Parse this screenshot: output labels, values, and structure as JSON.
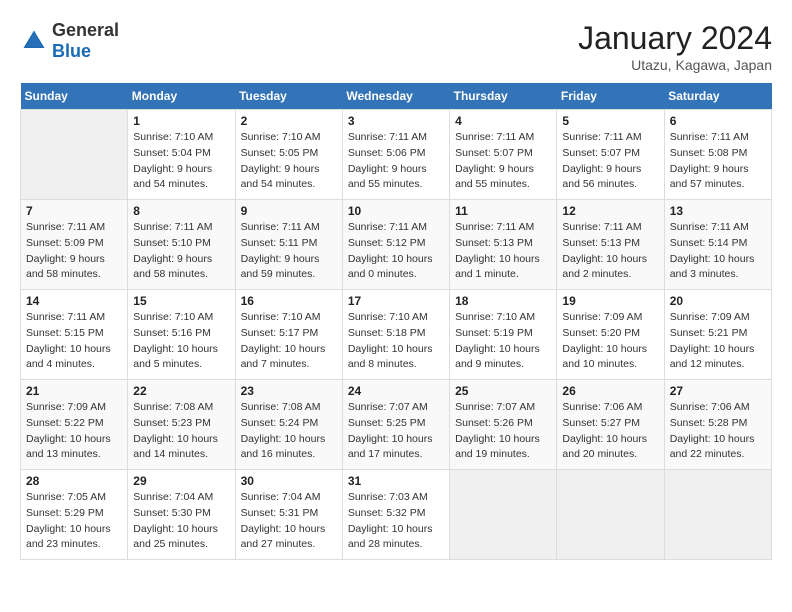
{
  "header": {
    "logo_general": "General",
    "logo_blue": "Blue",
    "main_title": "January 2024",
    "subtitle": "Utazu, Kagawa, Japan"
  },
  "calendar": {
    "columns": [
      "Sunday",
      "Monday",
      "Tuesday",
      "Wednesday",
      "Thursday",
      "Friday",
      "Saturday"
    ],
    "weeks": [
      [
        {
          "day": "",
          "info": ""
        },
        {
          "day": "1",
          "info": "Sunrise: 7:10 AM\nSunset: 5:04 PM\nDaylight: 9 hours\nand 54 minutes."
        },
        {
          "day": "2",
          "info": "Sunrise: 7:10 AM\nSunset: 5:05 PM\nDaylight: 9 hours\nand 54 minutes."
        },
        {
          "day": "3",
          "info": "Sunrise: 7:11 AM\nSunset: 5:06 PM\nDaylight: 9 hours\nand 55 minutes."
        },
        {
          "day": "4",
          "info": "Sunrise: 7:11 AM\nSunset: 5:07 PM\nDaylight: 9 hours\nand 55 minutes."
        },
        {
          "day": "5",
          "info": "Sunrise: 7:11 AM\nSunset: 5:07 PM\nDaylight: 9 hours\nand 56 minutes."
        },
        {
          "day": "6",
          "info": "Sunrise: 7:11 AM\nSunset: 5:08 PM\nDaylight: 9 hours\nand 57 minutes."
        }
      ],
      [
        {
          "day": "7",
          "info": "Sunrise: 7:11 AM\nSunset: 5:09 PM\nDaylight: 9 hours\nand 58 minutes."
        },
        {
          "day": "8",
          "info": "Sunrise: 7:11 AM\nSunset: 5:10 PM\nDaylight: 9 hours\nand 58 minutes."
        },
        {
          "day": "9",
          "info": "Sunrise: 7:11 AM\nSunset: 5:11 PM\nDaylight: 9 hours\nand 59 minutes."
        },
        {
          "day": "10",
          "info": "Sunrise: 7:11 AM\nSunset: 5:12 PM\nDaylight: 10 hours\nand 0 minutes."
        },
        {
          "day": "11",
          "info": "Sunrise: 7:11 AM\nSunset: 5:13 PM\nDaylight: 10 hours\nand 1 minute."
        },
        {
          "day": "12",
          "info": "Sunrise: 7:11 AM\nSunset: 5:13 PM\nDaylight: 10 hours\nand 2 minutes."
        },
        {
          "day": "13",
          "info": "Sunrise: 7:11 AM\nSunset: 5:14 PM\nDaylight: 10 hours\nand 3 minutes."
        }
      ],
      [
        {
          "day": "14",
          "info": "Sunrise: 7:11 AM\nSunset: 5:15 PM\nDaylight: 10 hours\nand 4 minutes."
        },
        {
          "day": "15",
          "info": "Sunrise: 7:10 AM\nSunset: 5:16 PM\nDaylight: 10 hours\nand 5 minutes."
        },
        {
          "day": "16",
          "info": "Sunrise: 7:10 AM\nSunset: 5:17 PM\nDaylight: 10 hours\nand 7 minutes."
        },
        {
          "day": "17",
          "info": "Sunrise: 7:10 AM\nSunset: 5:18 PM\nDaylight: 10 hours\nand 8 minutes."
        },
        {
          "day": "18",
          "info": "Sunrise: 7:10 AM\nSunset: 5:19 PM\nDaylight: 10 hours\nand 9 minutes."
        },
        {
          "day": "19",
          "info": "Sunrise: 7:09 AM\nSunset: 5:20 PM\nDaylight: 10 hours\nand 10 minutes."
        },
        {
          "day": "20",
          "info": "Sunrise: 7:09 AM\nSunset: 5:21 PM\nDaylight: 10 hours\nand 12 minutes."
        }
      ],
      [
        {
          "day": "21",
          "info": "Sunrise: 7:09 AM\nSunset: 5:22 PM\nDaylight: 10 hours\nand 13 minutes."
        },
        {
          "day": "22",
          "info": "Sunrise: 7:08 AM\nSunset: 5:23 PM\nDaylight: 10 hours\nand 14 minutes."
        },
        {
          "day": "23",
          "info": "Sunrise: 7:08 AM\nSunset: 5:24 PM\nDaylight: 10 hours\nand 16 minutes."
        },
        {
          "day": "24",
          "info": "Sunrise: 7:07 AM\nSunset: 5:25 PM\nDaylight: 10 hours\nand 17 minutes."
        },
        {
          "day": "25",
          "info": "Sunrise: 7:07 AM\nSunset: 5:26 PM\nDaylight: 10 hours\nand 19 minutes."
        },
        {
          "day": "26",
          "info": "Sunrise: 7:06 AM\nSunset: 5:27 PM\nDaylight: 10 hours\nand 20 minutes."
        },
        {
          "day": "27",
          "info": "Sunrise: 7:06 AM\nSunset: 5:28 PM\nDaylight: 10 hours\nand 22 minutes."
        }
      ],
      [
        {
          "day": "28",
          "info": "Sunrise: 7:05 AM\nSunset: 5:29 PM\nDaylight: 10 hours\nand 23 minutes."
        },
        {
          "day": "29",
          "info": "Sunrise: 7:04 AM\nSunset: 5:30 PM\nDaylight: 10 hours\nand 25 minutes."
        },
        {
          "day": "30",
          "info": "Sunrise: 7:04 AM\nSunset: 5:31 PM\nDaylight: 10 hours\nand 27 minutes."
        },
        {
          "day": "31",
          "info": "Sunrise: 7:03 AM\nSunset: 5:32 PM\nDaylight: 10 hours\nand 28 minutes."
        },
        {
          "day": "",
          "info": ""
        },
        {
          "day": "",
          "info": ""
        },
        {
          "day": "",
          "info": ""
        }
      ]
    ]
  }
}
